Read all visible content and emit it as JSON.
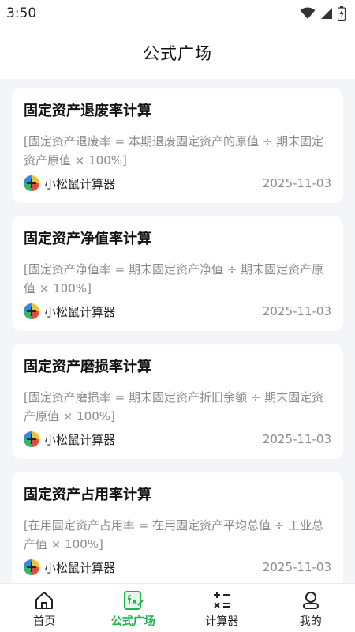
{
  "status_bar": {
    "time": "3:50"
  },
  "header": {
    "title": "公式广场"
  },
  "colors": {
    "accent": "#1fb14d",
    "text_muted": "#8a8a8a",
    "background": "#f3f5f8"
  },
  "cards": [
    {
      "title": "固定资产退废率计算",
      "formula": "[固定资产退废率 = 本期退废固定资产的原值 ÷ 期末固定资产原值 × 100%]",
      "author": "小松鼠计算器",
      "date": "2025-11-03"
    },
    {
      "title": "固定资产净值率计算",
      "formula": "[固定资产净值率 = 期末固定资产净值 ÷ 期末固定资产原值 × 100%]",
      "author": "小松鼠计算器",
      "date": "2025-11-03"
    },
    {
      "title": "固定资产磨损率计算",
      "formula": "[固定资产磨损率 = 期末固定资产折旧余额 ÷ 期末固定资产原值 × 100%]",
      "author": "小松鼠计算器",
      "date": "2025-11-03"
    },
    {
      "title": "固定资产占用率计算",
      "formula": "[在用固定资产占用率 = 在用固定资产平均总值 ÷ 工业总产值 × 100%]",
      "author": "小松鼠计算器",
      "date": "2025-11-03"
    }
  ],
  "nav": [
    {
      "label": "首页",
      "icon": "home-icon",
      "active": false
    },
    {
      "label": "公式广场",
      "icon": "formula-icon",
      "active": true
    },
    {
      "label": "计算器",
      "icon": "calculator-icon",
      "active": false
    },
    {
      "label": "我的",
      "icon": "profile-icon",
      "active": false
    }
  ]
}
